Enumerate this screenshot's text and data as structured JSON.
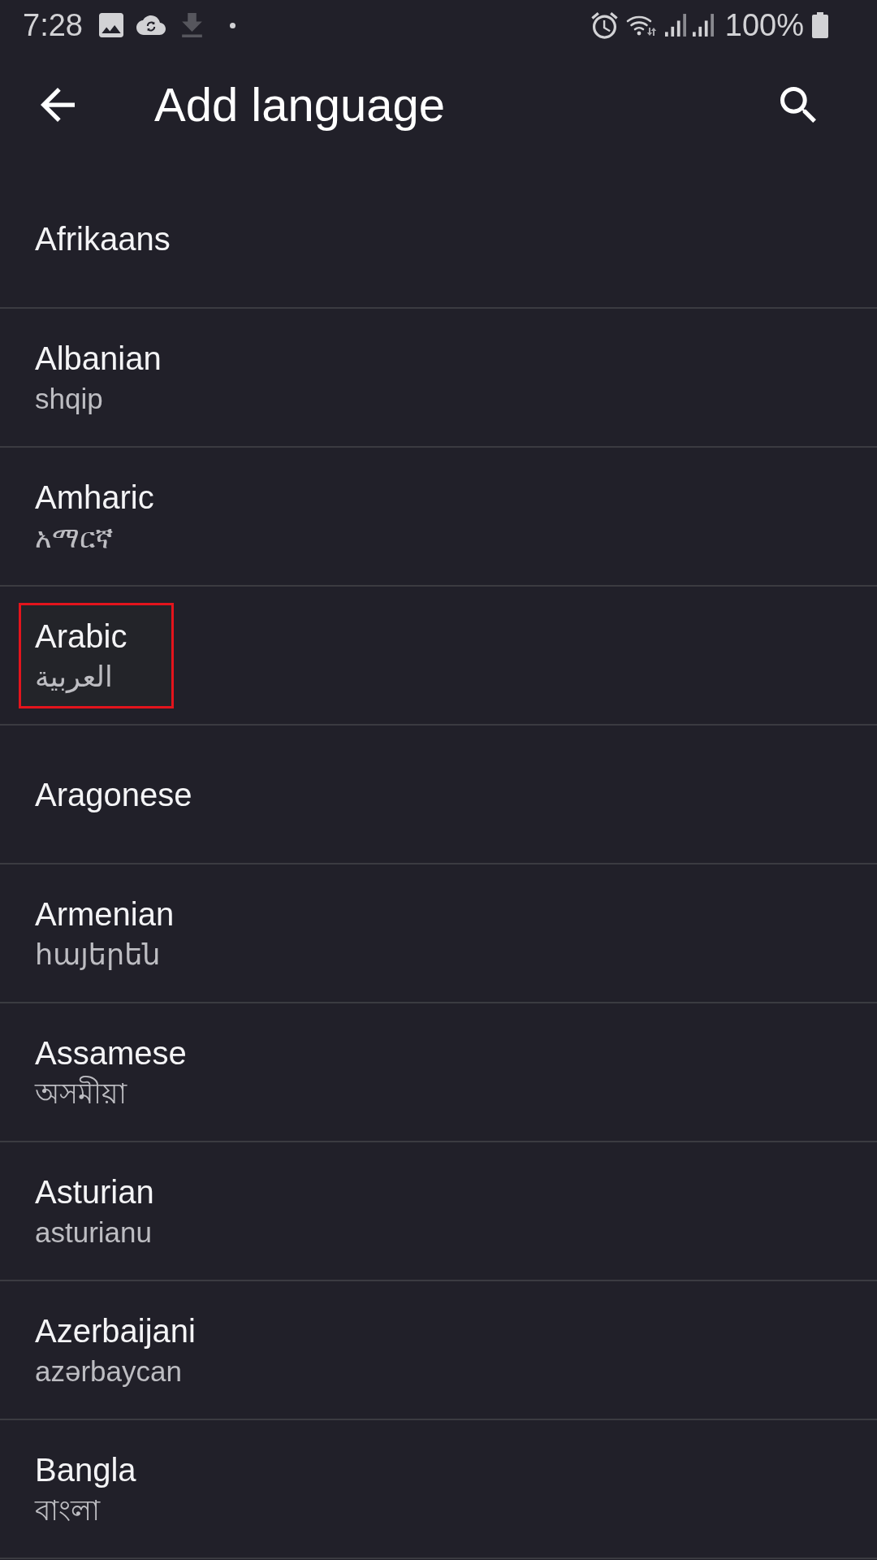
{
  "status_bar": {
    "time": "7:28",
    "battery": "100%"
  },
  "app_bar": {
    "title": "Add language"
  },
  "languages": [
    {
      "name": "Afrikaans",
      "highlighted": false
    },
    {
      "name": "Albanian",
      "native_name": "shqip",
      "highlighted": false
    },
    {
      "name": "Amharic",
      "native_name": "አማርኛ",
      "highlighted": false
    },
    {
      "name": "Arabic",
      "native_name": "العربية",
      "highlighted": true
    },
    {
      "name": "Aragonese",
      "highlighted": false
    },
    {
      "name": "Armenian",
      "native_name": "հայերեն",
      "highlighted": false
    },
    {
      "name": "Assamese",
      "native_name": "অসমীয়া",
      "highlighted": false
    },
    {
      "name": "Asturian",
      "native_name": "asturianu",
      "highlighted": false
    },
    {
      "name": "Azerbaijani",
      "native_name": "azərbaycan",
      "highlighted": false
    },
    {
      "name": "Bangla",
      "native_name": "বাংলা",
      "highlighted": false
    }
  ]
}
